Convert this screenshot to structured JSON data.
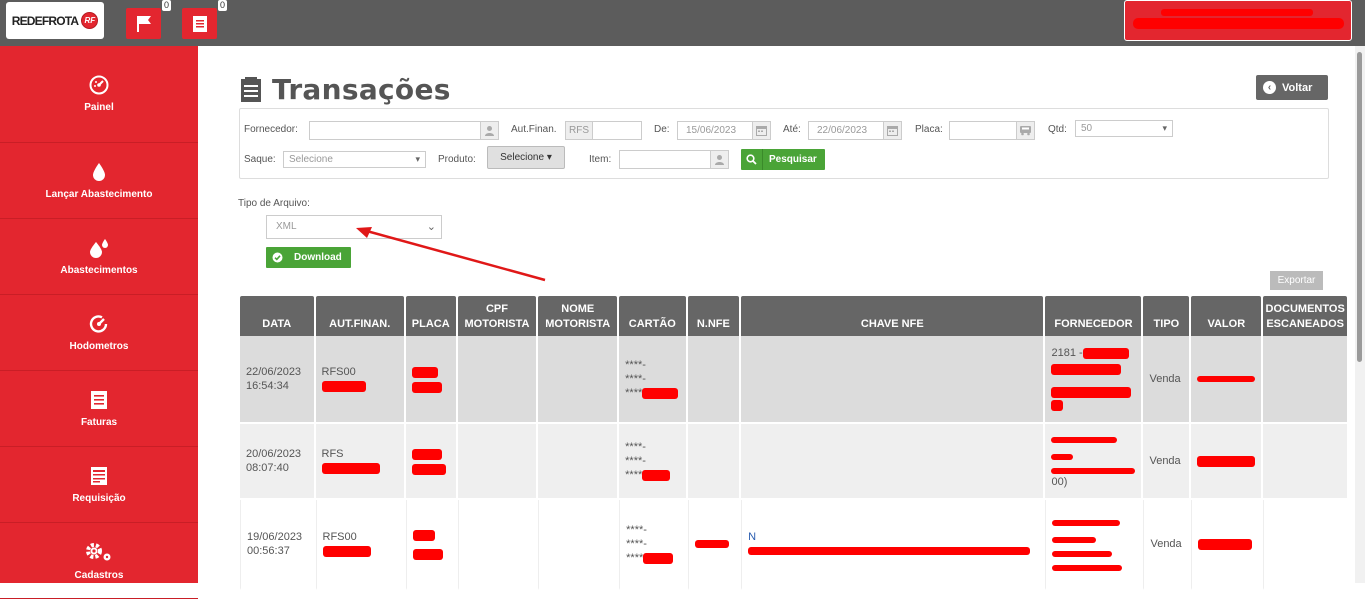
{
  "topbar": {
    "logo_text": "REDEFROTA",
    "logo_mark": "RF",
    "flag_badge": "0",
    "doc_badge": "0"
  },
  "sidebar": {
    "items": [
      {
        "label": "Painel",
        "icon": "dashboard-icon"
      },
      {
        "label": "Lançar Abastecimento",
        "icon": "drop-icon"
      },
      {
        "label": "Abastecimentos",
        "icon": "drops-icon"
      },
      {
        "label": "Hodometros",
        "icon": "odometer-icon"
      },
      {
        "label": "Faturas",
        "icon": "invoice-icon"
      },
      {
        "label": "Requisição",
        "icon": "requisition-icon"
      },
      {
        "label": "Cadastros",
        "icon": "gears-icon"
      }
    ]
  },
  "page": {
    "title": "Transações",
    "back_label": "Voltar"
  },
  "filters": {
    "fornecedor_label": "Fornecedor:",
    "fornecedor_value": "",
    "autfinan_label": "Aut.Finan.",
    "autfinan_prefix": "RFS",
    "de_label": "De:",
    "de_value": "15/06/2023",
    "ate_label": "Até:",
    "ate_value": "22/06/2023",
    "placa_label": "Placa:",
    "qtd_label": "Qtd:",
    "qtd_value": "50",
    "saque_label": "Saque:",
    "saque_value": "Selecione",
    "produto_label": "Produto:",
    "produto_value": "Selecione",
    "item_label": "Item:",
    "search_label": "Pesquisar"
  },
  "download": {
    "tipo_label": "Tipo de Arquivo:",
    "tipo_value": "XML",
    "download_label": "Download",
    "export_label": "Exportar"
  },
  "table": {
    "headers": [
      "DATA",
      "AUT.FINAN.",
      "PLACA",
      "CPF MOTORISTA",
      "NOME MOTORISTA",
      "CARTÃO",
      "N.NFE",
      "CHAVE NFE",
      "FORNECEDOR",
      "TIPO",
      "VALOR",
      "DOCUMENTOS ESCANEADOS"
    ],
    "rows": [
      {
        "date": "22/06/2023",
        "time": "16:54:34",
        "aut": "RFS00",
        "card1": "****-",
        "card2": "****-",
        "card3": "****",
        "fornecedor": "2181 -",
        "tipo": "Venda"
      },
      {
        "date": "20/06/2023",
        "time": "08:07:40",
        "aut": "RFS",
        "card1": "****-",
        "card2": "****-",
        "card3": "****",
        "fornecedor": "00)",
        "tipo": "Venda"
      },
      {
        "date": "19/06/2023",
        "time": "00:56:37",
        "aut": "RFS00",
        "card1": "****-",
        "card2": "****-",
        "card3": "****",
        "fornecedor": "",
        "tipo": "Venda"
      }
    ]
  },
  "colors": {
    "brand": "#e3262f",
    "topbar": "#5c5c5c",
    "green": "#4aa437",
    "redaction": "#ff0000"
  }
}
